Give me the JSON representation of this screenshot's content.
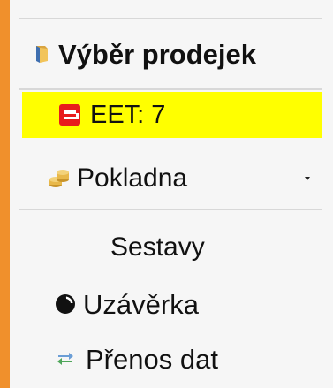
{
  "colors": {
    "accent_bar": "#f0902c",
    "eet_highlight": "#ffff00",
    "eet_icon": "#e81c1c",
    "panel_background": "#f6f6f6"
  },
  "menu": {
    "title": {
      "label": "Výběr prodejek",
      "icon": "folder-icon"
    },
    "eet": {
      "label": "EET: 7",
      "icon": "eet-logo-icon",
      "highlighted": true
    },
    "pokladna": {
      "label": "Pokladna",
      "icon": "coins-icon",
      "has_dropdown": true
    },
    "sestavy": {
      "label": "Sestavy"
    },
    "uzaverka": {
      "label": "Uzávěrka",
      "icon": "moon-icon"
    },
    "prenos": {
      "label": "Přenos dat",
      "icon": "transfer-arrows-icon"
    }
  }
}
